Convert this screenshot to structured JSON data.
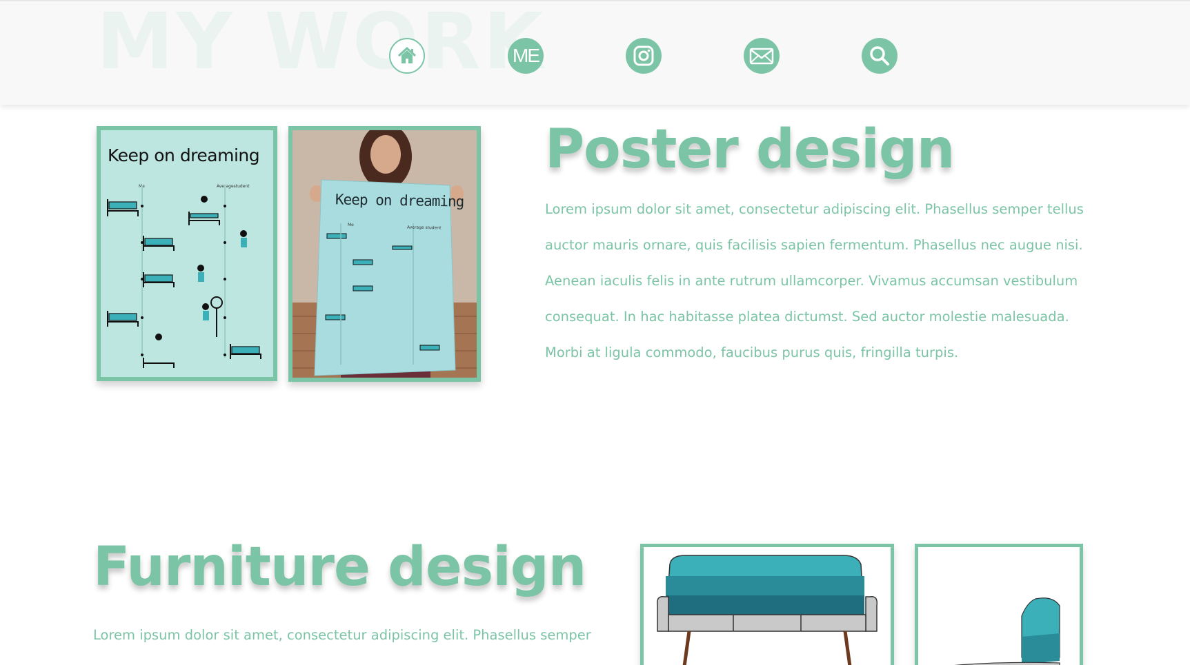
{
  "header": {
    "bg_title": "MY WORK",
    "nav": [
      {
        "name": "home",
        "icon": "home-icon"
      },
      {
        "name": "me",
        "label": "ME"
      },
      {
        "name": "instagram",
        "icon": "instagram-icon"
      },
      {
        "name": "mail",
        "icon": "mail-icon"
      },
      {
        "name": "search",
        "icon": "search-icon"
      }
    ]
  },
  "poster": {
    "heading": "Poster design",
    "body": "Lorem ipsum dolor sit amet, consectetur adipiscing elit. Phasellus semper tellus auctor mauris ornare, quis facilisis sapien fermentum. Phasellus nec augue nisi. Aenean iaculis felis in ante rutrum ullamcorper. Vivamus accumsan vestibulum consequat. In hac habitasse platea dictumst. Sed auctor molestie malesuada. Morbi at ligula commodo, faucibus purus quis, fringilla turpis.",
    "image1_title": "Keep on dreaming",
    "image1_col_left": "Me",
    "image1_col_right": "Averagestudent",
    "image2_title": "Keep on dreaming",
    "image2_col_left": "Me",
    "image2_col_right": "Average student"
  },
  "furniture": {
    "heading": "Furniture design",
    "body": "Lorem ipsum dolor sit amet, consectetur adipiscing elit. Phasellus semper"
  },
  "colors": {
    "accent": "#7cc4a6",
    "header_bg": "#f8f8f8",
    "poster_bg": "#bde6e0",
    "sofa_teal": "#3bb0b8"
  }
}
